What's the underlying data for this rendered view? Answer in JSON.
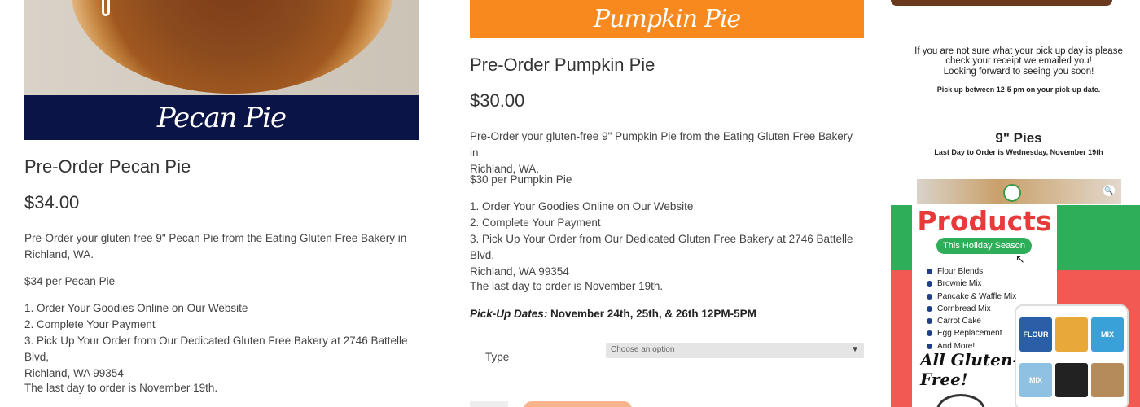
{
  "pecan": {
    "banner_text": "Pecan Pie",
    "title": "Pre-Order Pecan Pie",
    "price": "$34.00",
    "desc_line1": "Pre-Order your gluten free 9\" Pecan Pie from the Eating Gluten Free Bakery in",
    "desc_line2": "Richland, WA.",
    "per_item": "$34 per Pecan Pie",
    "step1": "1. Order Your Goodies Online on Our Website",
    "step2": "2. Complete Your Payment",
    "step3_line1": "3. Pick Up Your Order from Our Dedicated Gluten Free Bakery at 2746 Battelle Blvd,",
    "step3_line2": "Richland, WA 99354",
    "last_day": "The last day to order is November 19th."
  },
  "pumpkin": {
    "banner_text": "Pumpkin Pie",
    "title": "Pre-Order Pumpkin Pie",
    "price": "$30.00",
    "desc_line1": "Pre-Order your gluten-free 9\" Pumpkin Pie from the Eating Gluten Free Bakery in",
    "desc_line2": "Richland, WA.",
    "per_item": "$30 per Pumpkin Pie",
    "step1": "1. Order Your Goodies Online on Our Website",
    "step2": "2. Complete Your Payment",
    "step3_line1": "3. Pick Up Your Order from Our Dedicated Gluten Free Bakery at 2746 Battelle Blvd,",
    "step3_line2": "Richland, WA 99354",
    "last_day": "The last day to order is November 19th.",
    "pickup_label": "Pick-Up Dates:",
    "pickup_value": " November 24th, 25th, & 26th 12PM-5PM",
    "type_label": "Type",
    "select_placeholder": "Choose an option"
  },
  "sidebar": {
    "notice_line1": "If you are not sure what your pick up day is please",
    "notice_line2": "check your receipt we emailed you!",
    "notice_line3": "Looking forward to seeing you soon!",
    "notice_line4": "Pick up between 12-5 pm on your pick-up date.",
    "pies_heading": "9\" Pies",
    "pies_sub": "Last Day to Order is Wednesday, November 19th",
    "promo_title": "Products",
    "promo_pill": "This Holiday Season",
    "promo_items": [
      "Flour Blends",
      "Brownie Mix",
      "Pancake & Waffle Mix",
      "Cornbread Mix",
      "Carrot Cake",
      "Egg Replacement",
      "And More!"
    ],
    "promo_footer": "All Gluten-Free!",
    "tile1": "FLOUR",
    "tile2": "MIX",
    "tile3": "MIX"
  },
  "colors": {
    "navy": "#0a1446",
    "orange": "#f7891f",
    "green": "#2fae5a",
    "red": "#f05a52"
  },
  "icons": {
    "zoom": "magnifier-icon",
    "select_arrow": "chevron-down-icon"
  }
}
